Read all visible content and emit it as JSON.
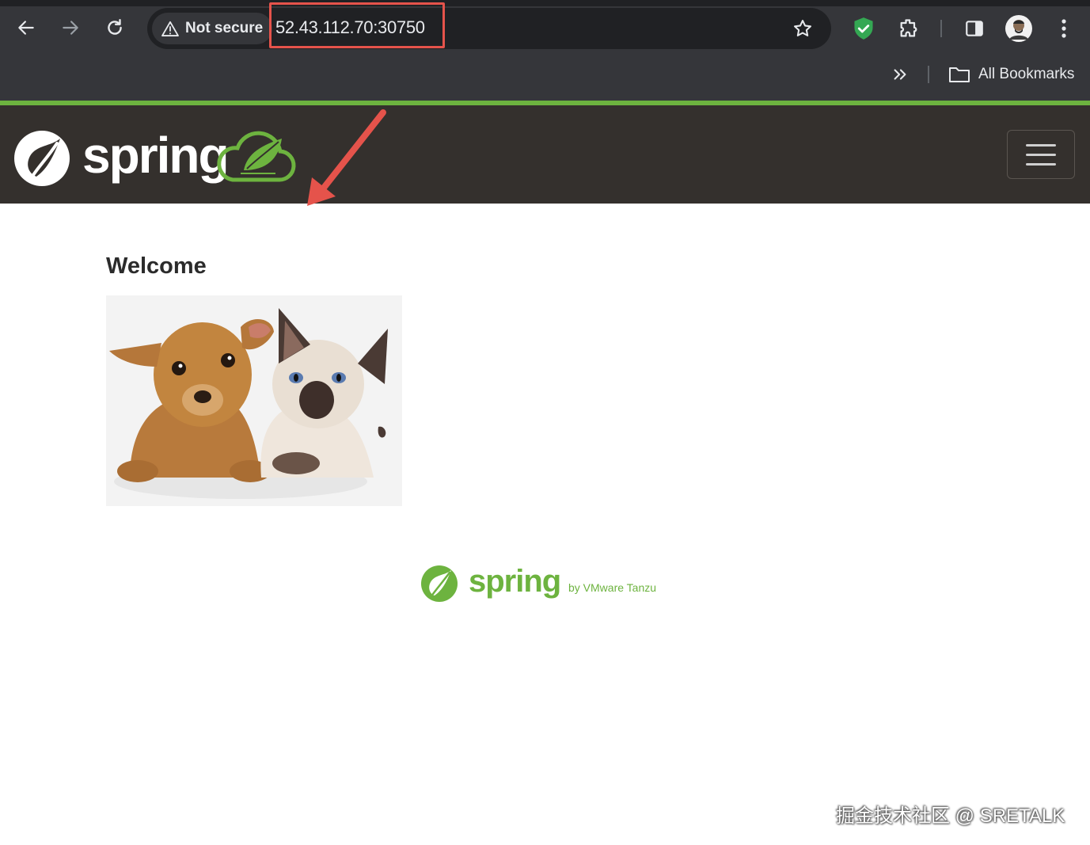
{
  "browser": {
    "security_label": "Not secure",
    "url": "52.43.112.70:30750",
    "bookmarks_label": "All Bookmarks",
    "icons": [
      "back-arrow-icon",
      "forward-arrow-icon",
      "reload-icon",
      "warning-icon",
      "star-icon",
      "shield-check-icon",
      "extensions-icon",
      "side-panel-icon",
      "avatar",
      "kebab-menu-icon",
      "double-chevron-icon",
      "folder-icon"
    ]
  },
  "site": {
    "brand": "spring",
    "menu_icon": "hamburger-icon"
  },
  "main": {
    "heading": "Welcome",
    "image": "dog-and-cat-photo"
  },
  "footer": {
    "brand": "spring",
    "tagline": "by VMware Tanzu"
  },
  "watermark": "掘金技术社区 @ SRETALK",
  "colors": {
    "spring_green": "#6db33f",
    "header_bg": "#34302d",
    "chrome_bg": "#35363a",
    "highlight_red": "#e5534b"
  }
}
